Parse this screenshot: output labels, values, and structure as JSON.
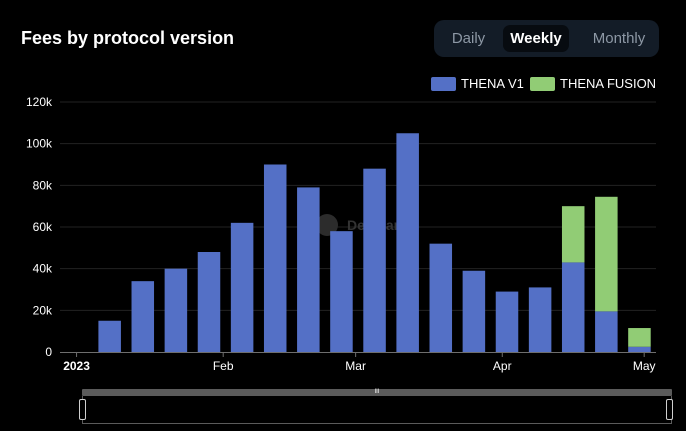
{
  "title": "Fees by protocol version",
  "toggle": {
    "options": [
      "Daily",
      "Weekly",
      "Monthly"
    ],
    "active": "Weekly"
  },
  "watermark": "DefiLlama",
  "scrollbar": {
    "grip_label": "III"
  },
  "colors": {
    "v1": "#5470c6",
    "fusion": "#91cc75",
    "background": "#000000",
    "grid": "#222222",
    "axis_text": "#ffffff"
  },
  "chart_data": {
    "type": "bar",
    "stacked": true,
    "categories": [
      "2023-01-01",
      "2023-01-08",
      "2023-01-15",
      "2023-01-22",
      "2023-01-29",
      "2023-02-05",
      "2023-02-12",
      "2023-02-19",
      "2023-02-26",
      "2023-03-05",
      "2023-03-12",
      "2023-03-19",
      "2023-03-26",
      "2023-04-02",
      "2023-04-09",
      "2023-04-16",
      "2023-04-23",
      "2023-04-30"
    ],
    "series": [
      {
        "name": "THENA V1",
        "color": "#5470c6",
        "values": [
          0,
          15000,
          34000,
          40000,
          48000,
          62000,
          90000,
          79000,
          58000,
          88000,
          105000,
          52000,
          39000,
          29000,
          31000,
          43000,
          19500,
          2500
        ]
      },
      {
        "name": "THENA FUSION",
        "color": "#91cc75",
        "values": [
          0,
          0,
          0,
          0,
          0,
          0,
          0,
          0,
          0,
          0,
          0,
          0,
          0,
          0,
          0,
          27000,
          55000,
          9000
        ]
      }
    ],
    "ylim": [
      0,
      120000
    ],
    "yticks": [
      0,
      20000,
      40000,
      60000,
      80000,
      100000,
      120000
    ],
    "ytick_labels": [
      "0",
      "20k",
      "40k",
      "60k",
      "80k",
      "100k",
      "120k"
    ],
    "xtick_labels": [
      {
        "label": "2023",
        "at": "2023-01-01",
        "bold": true
      },
      {
        "label": "Feb",
        "at": "2023-02-01",
        "bold": false
      },
      {
        "label": "Mar",
        "at": "2023-03-01",
        "bold": false
      },
      {
        "label": "Apr",
        "at": "2023-04-01",
        "bold": false
      },
      {
        "label": "May",
        "at": "2023-05-01",
        "bold": false
      }
    ],
    "xlabel": "",
    "ylabel": "",
    "grid": true,
    "legend_position": "top-right"
  }
}
